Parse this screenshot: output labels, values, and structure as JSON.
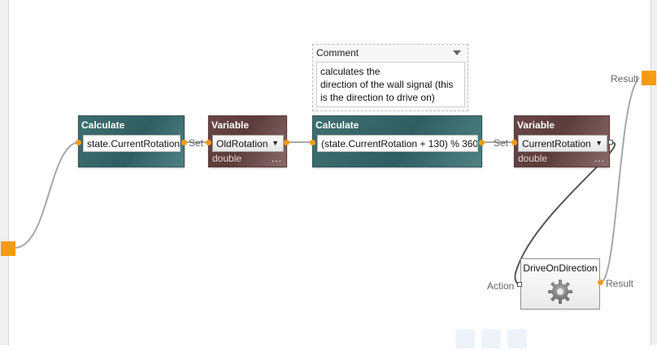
{
  "nodes": {
    "calc1": {
      "title": "Calculate",
      "expression": "state.CurrentRotation"
    },
    "var1": {
      "title": "Variable",
      "selected": "OldRotation",
      "type": "double",
      "more": "..."
    },
    "calc2": {
      "title": "Calculate",
      "expression": "(state.CurrentRotation + 130) % 360"
    },
    "var2": {
      "title": "Variable",
      "selected": "CurrentRotation",
      "type": "double",
      "more": "..."
    },
    "activity": {
      "title": "DriveOnDirection",
      "icon": "gear-icon"
    }
  },
  "comment": {
    "title": "Comment",
    "text": "calculates the\ndirection of the wall signal (this\nis the direction to drive on)"
  },
  "connector_labels": {
    "set1": "Set",
    "set2": "Set",
    "result_top": "Result",
    "action": "Action",
    "result_activity": "Result"
  },
  "colors": {
    "calculate": "#2f5e62",
    "variable": "#5b3b3b",
    "port": "#f39c12",
    "wire": "#a0a0a0"
  }
}
